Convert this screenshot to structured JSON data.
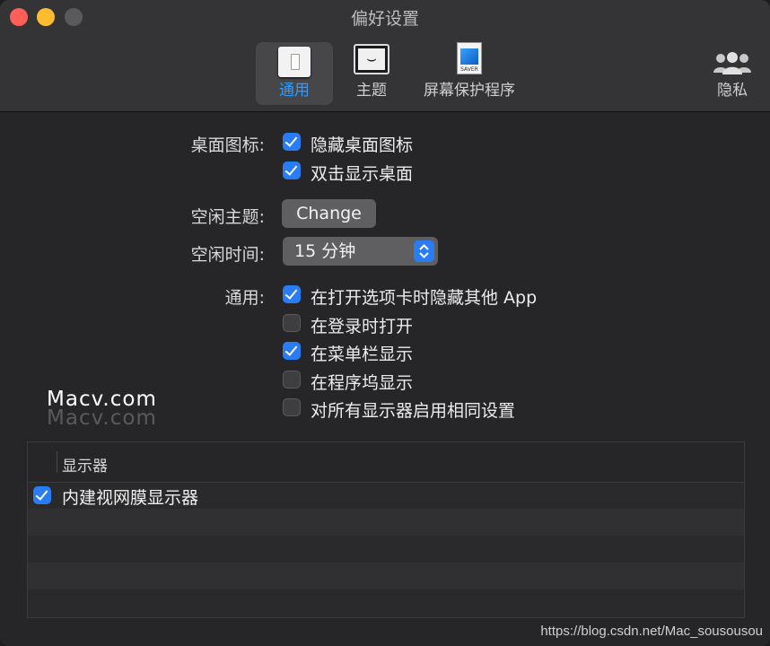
{
  "window": {
    "title": "偏好设置"
  },
  "toolbar": {
    "tabs": [
      {
        "label": "通用",
        "icon": "switch-icon"
      },
      {
        "label": "主题",
        "icon": "monitor-icon"
      },
      {
        "label": "屏幕保护程序",
        "icon": "screensaver-file-icon",
        "file_text": "SAVER"
      },
      {
        "label": "隐私",
        "icon": "people-icon"
      }
    ],
    "selected": "通用"
  },
  "desktop_icons": {
    "label": "桌面图标:",
    "options": [
      {
        "text": "隐藏桌面图标",
        "checked": true
      },
      {
        "text": "双击显示桌面",
        "checked": true
      }
    ]
  },
  "idle_theme": {
    "label": "空闲主题:",
    "button": "Change"
  },
  "idle_time": {
    "label": "空闲时间:",
    "value": "15 分钟"
  },
  "general": {
    "label": "通用:",
    "options": [
      {
        "text": "在打开选项卡时隐藏其他 App",
        "checked": true
      },
      {
        "text": "在登录时打开",
        "checked": false
      },
      {
        "text": "在菜单栏显示",
        "checked": true
      },
      {
        "text": "在程序坞显示",
        "checked": false
      },
      {
        "text": "对所有显示器启用相同设置",
        "checked": false
      }
    ]
  },
  "watermark": {
    "line1": "Macv.com",
    "line2": "Macv.com"
  },
  "displays_table": {
    "header": "显示器",
    "rows": [
      {
        "text": "内建视网膜显示器",
        "checked": true
      }
    ]
  },
  "footer": {
    "url": "https://blog.csdn.net/Mac_sousousou"
  },
  "colors": {
    "accent": "#2a7cf5",
    "selected_tab_text": "#2f9bff"
  }
}
